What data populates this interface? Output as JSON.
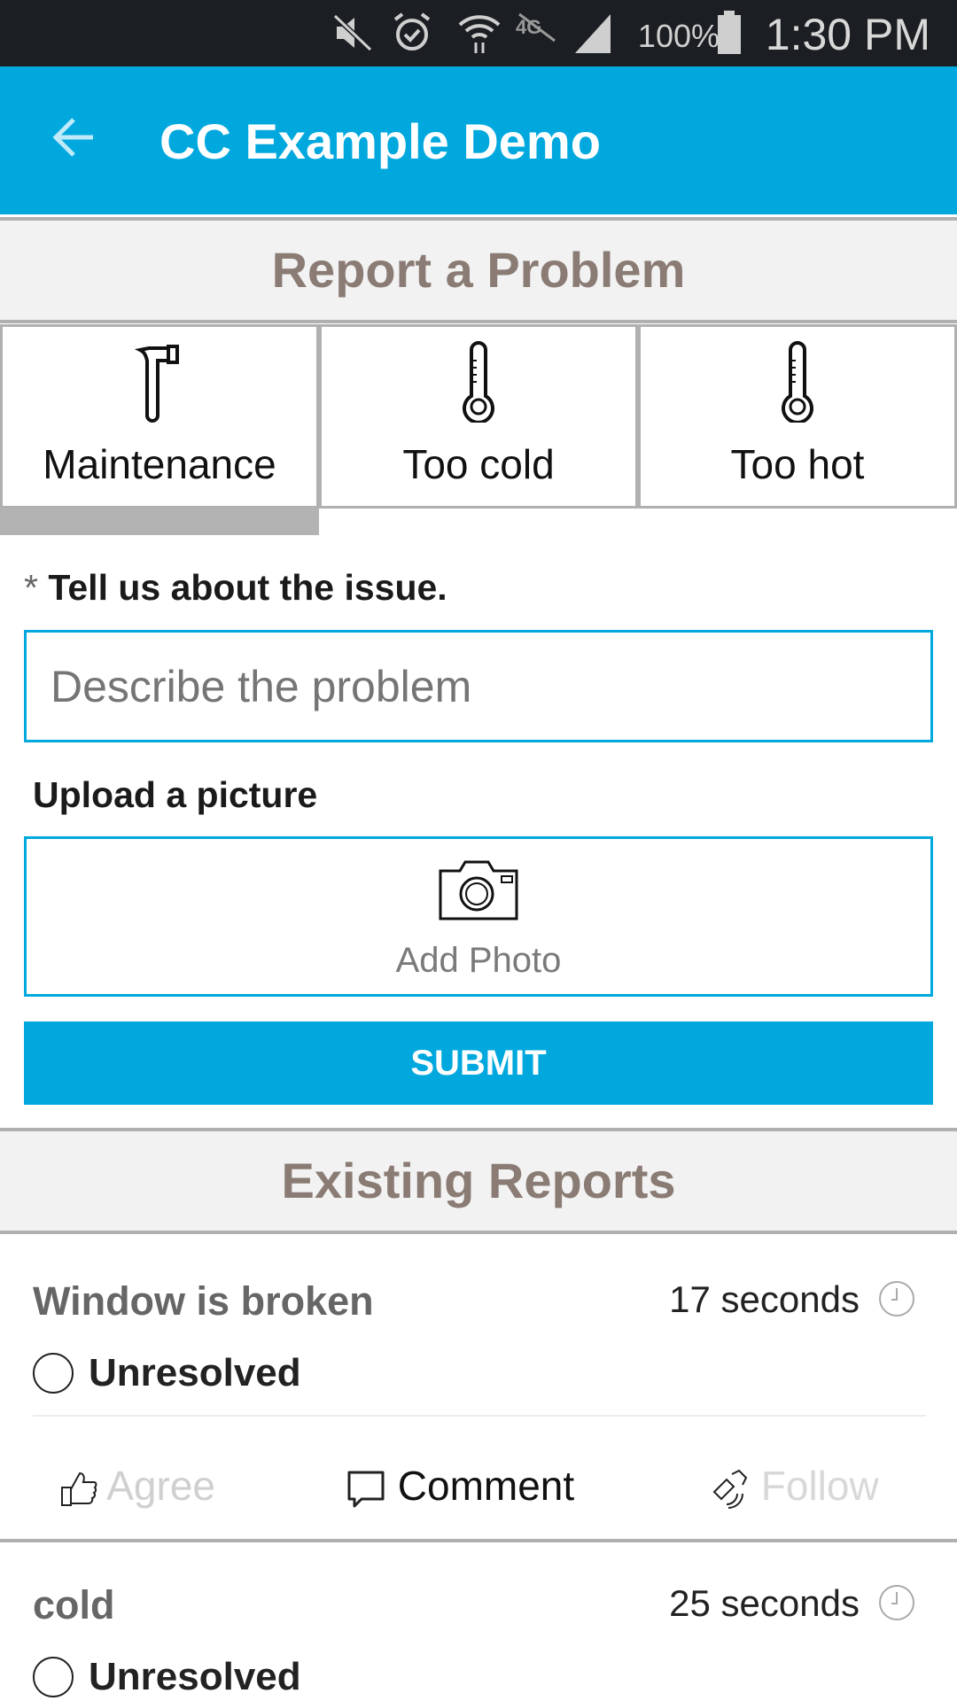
{
  "status_bar": {
    "battery": "100%",
    "time": "1:30 PM",
    "icons": [
      "mute-icon",
      "alarm-icon",
      "wifi-icon",
      "4g-lte-icon",
      "signal-icon",
      "battery-icon"
    ]
  },
  "app_bar": {
    "title": "CC Example Demo",
    "back_icon": "arrow-left-icon"
  },
  "report": {
    "heading": "Report a Problem",
    "categories": [
      {
        "label": "Maintenance",
        "icon": "hammer-icon",
        "selected": true
      },
      {
        "label": "Too cold",
        "icon": "thermometer-icon",
        "selected": false
      },
      {
        "label": "Too hot",
        "icon": "thermometer-icon",
        "selected": false
      }
    ],
    "required_mark": "*",
    "issue_label": "Tell us about the issue.",
    "issue_placeholder": "Describe the problem",
    "upload_label": "Upload a picture",
    "add_photo": "Add Photo",
    "submit": "SUBMIT"
  },
  "existing": {
    "heading": "Existing Reports",
    "reports": [
      {
        "title": "Window is broken",
        "age": "17 seconds",
        "status": "Unresolved",
        "actions": {
          "agree": "Agree",
          "comment": "Comment",
          "follow": "Follow"
        }
      },
      {
        "title": "cold",
        "age": "25 seconds",
        "status": "Unresolved"
      }
    ]
  },
  "colors": {
    "accent": "#00a8de",
    "heading": "#8a7c74",
    "status_bar": "#1b1e22"
  }
}
